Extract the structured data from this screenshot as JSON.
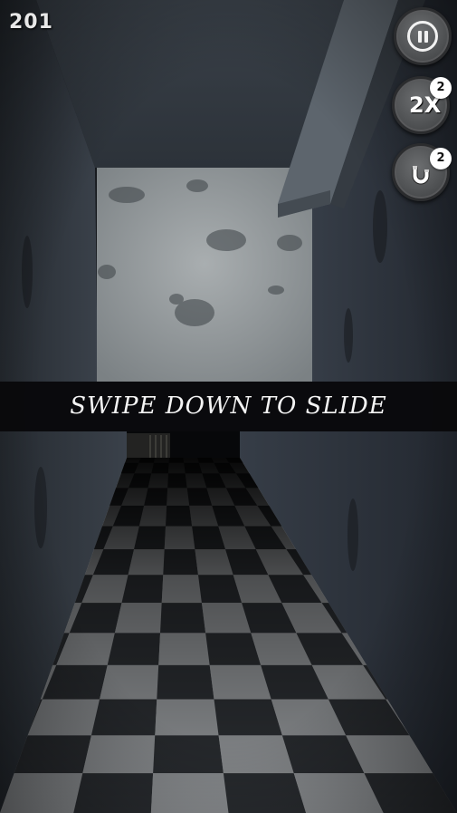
{
  "hud": {
    "score": "201",
    "pause_icon": "pause-icon",
    "double_powerup": {
      "label": "2X",
      "count": "2",
      "icon": "double-score-icon"
    },
    "magnet_powerup": {
      "count": "2",
      "icon": "magnet-icon"
    }
  },
  "hint": {
    "text": "SWIPE DOWN TO SLIDE"
  },
  "colors": {
    "banner": "#0a0a0c",
    "hud_button": "#4a4c4e",
    "badge": "#ffffff",
    "text": "#f4f4f4"
  }
}
